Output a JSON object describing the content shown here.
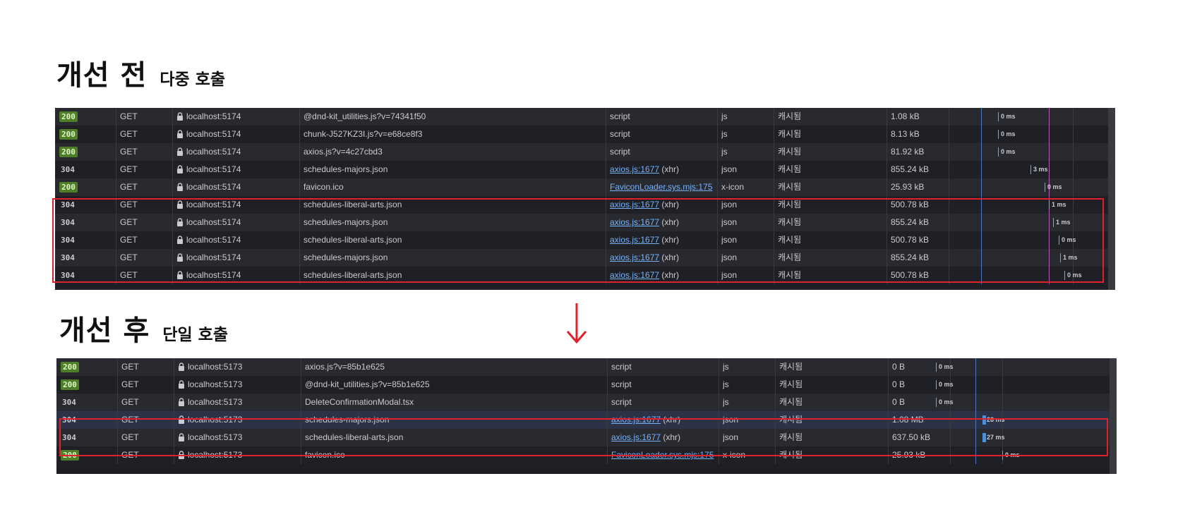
{
  "before": {
    "title": "개선 전",
    "subtitle": "다중 호출",
    "rows": [
      {
        "status": "200",
        "method": "GET",
        "domain": "localhost:5174",
        "file": "@dnd-kit_utilities.js?v=74341f50",
        "initiator_link": "",
        "initiator_text": "script",
        "type": "js",
        "cache": "캐시됨",
        "size": "1.08 kB",
        "time": "0 ms"
      },
      {
        "status": "200",
        "method": "GET",
        "domain": "localhost:5174",
        "file": "chunk-J527KZ3I.js?v=e68ce8f3",
        "initiator_link": "",
        "initiator_text": "script",
        "type": "js",
        "cache": "캐시됨",
        "size": "8.13 kB",
        "time": "0 ms"
      },
      {
        "status": "200",
        "method": "GET",
        "domain": "localhost:5174",
        "file": "axios.js?v=4c27cbd3",
        "initiator_link": "",
        "initiator_text": "script",
        "type": "js",
        "cache": "캐시됨",
        "size": "81.92 kB",
        "time": "0 ms"
      },
      {
        "status": "304",
        "method": "GET",
        "domain": "localhost:5174",
        "file": "schedules-majors.json",
        "initiator_link": "axios.js:1677",
        "initiator_text": "(xhr)",
        "type": "json",
        "cache": "캐시됨",
        "size": "855.24 kB",
        "time": "3 ms"
      },
      {
        "status": "200",
        "method": "GET",
        "domain": "localhost:5174",
        "file": "favicon.ico",
        "initiator_link": "FaviconLoader.sys.mjs:175",
        "initiator_text": "…",
        "type": "x-icon",
        "cache": "캐시됨",
        "size": "25.93 kB",
        "time": "0 ms"
      },
      {
        "status": "304",
        "method": "GET",
        "domain": "localhost:5174",
        "file": "schedules-liberal-arts.json",
        "initiator_link": "axios.js:1677",
        "initiator_text": "(xhr)",
        "type": "json",
        "cache": "캐시됨",
        "size": "500.78 kB",
        "time": "1 ms"
      },
      {
        "status": "304",
        "method": "GET",
        "domain": "localhost:5174",
        "file": "schedules-majors.json",
        "initiator_link": "axios.js:1677",
        "initiator_text": "(xhr)",
        "type": "json",
        "cache": "캐시됨",
        "size": "855.24 kB",
        "time": "1 ms"
      },
      {
        "status": "304",
        "method": "GET",
        "domain": "localhost:5174",
        "file": "schedules-liberal-arts.json",
        "initiator_link": "axios.js:1677",
        "initiator_text": "(xhr)",
        "type": "json",
        "cache": "캐시됨",
        "size": "500.78 kB",
        "time": "0 ms"
      },
      {
        "status": "304",
        "method": "GET",
        "domain": "localhost:5174",
        "file": "schedules-majors.json",
        "initiator_link": "axios.js:1677",
        "initiator_text": "(xhr)",
        "type": "json",
        "cache": "캐시됨",
        "size": "855.24 kB",
        "time": "1 ms"
      },
      {
        "status": "304",
        "method": "GET",
        "domain": "localhost:5174",
        "file": "schedules-liberal-arts.json",
        "initiator_link": "axios.js:1677",
        "initiator_text": "(xhr)",
        "type": "json",
        "cache": "캐시됨",
        "size": "500.78 kB",
        "time": "0 ms"
      }
    ]
  },
  "after": {
    "title": "개선 후",
    "subtitle": "단일 호출",
    "rows": [
      {
        "status": "200",
        "method": "GET",
        "domain": "localhost:5173",
        "file": "axios.js?v=85b1e625",
        "initiator_link": "",
        "initiator_text": "script",
        "type": "js",
        "cache": "캐시됨",
        "size": "0 B",
        "time": "0 ms"
      },
      {
        "status": "200",
        "method": "GET",
        "domain": "localhost:5173",
        "file": "@dnd-kit_utilities.js?v=85b1e625",
        "initiator_link": "",
        "initiator_text": "script",
        "type": "js",
        "cache": "캐시됨",
        "size": "0 B",
        "time": "0 ms"
      },
      {
        "status": "304",
        "method": "GET",
        "domain": "localhost:5173",
        "file": "DeleteConfirmationModal.tsx",
        "initiator_link": "",
        "initiator_text": "script",
        "type": "js",
        "cache": "캐시됨",
        "size": "0 B",
        "time": "0 ms"
      },
      {
        "status": "304",
        "method": "GET",
        "domain": "localhost:5173",
        "file": "schedules-majors.json",
        "initiator_link": "axios.js:1677",
        "initiator_text": "(xhr)",
        "type": "json",
        "cache": "캐시됨",
        "size": "1.08 MB",
        "time": "26 ms"
      },
      {
        "status": "304",
        "method": "GET",
        "domain": "localhost:5173",
        "file": "schedules-liberal-arts.json",
        "initiator_link": "axios.js:1677",
        "initiator_text": "(xhr)",
        "type": "json",
        "cache": "캐시됨",
        "size": "637.50 kB",
        "time": "27 ms"
      },
      {
        "status": "200",
        "method": "GET",
        "domain": "localhost:5173",
        "file": "favicon.ico",
        "initiator_link": "FaviconLoader.sys.mjs:175",
        "initiator_text": "…",
        "type": "x-icon",
        "cache": "캐시됨",
        "size": "25.93 kB",
        "time": "0 ms"
      }
    ]
  },
  "colors": {
    "status_ok": "#4e7e28",
    "highlight": "#e0212c",
    "arrow": "#e0212c",
    "link": "#75b3ff"
  }
}
